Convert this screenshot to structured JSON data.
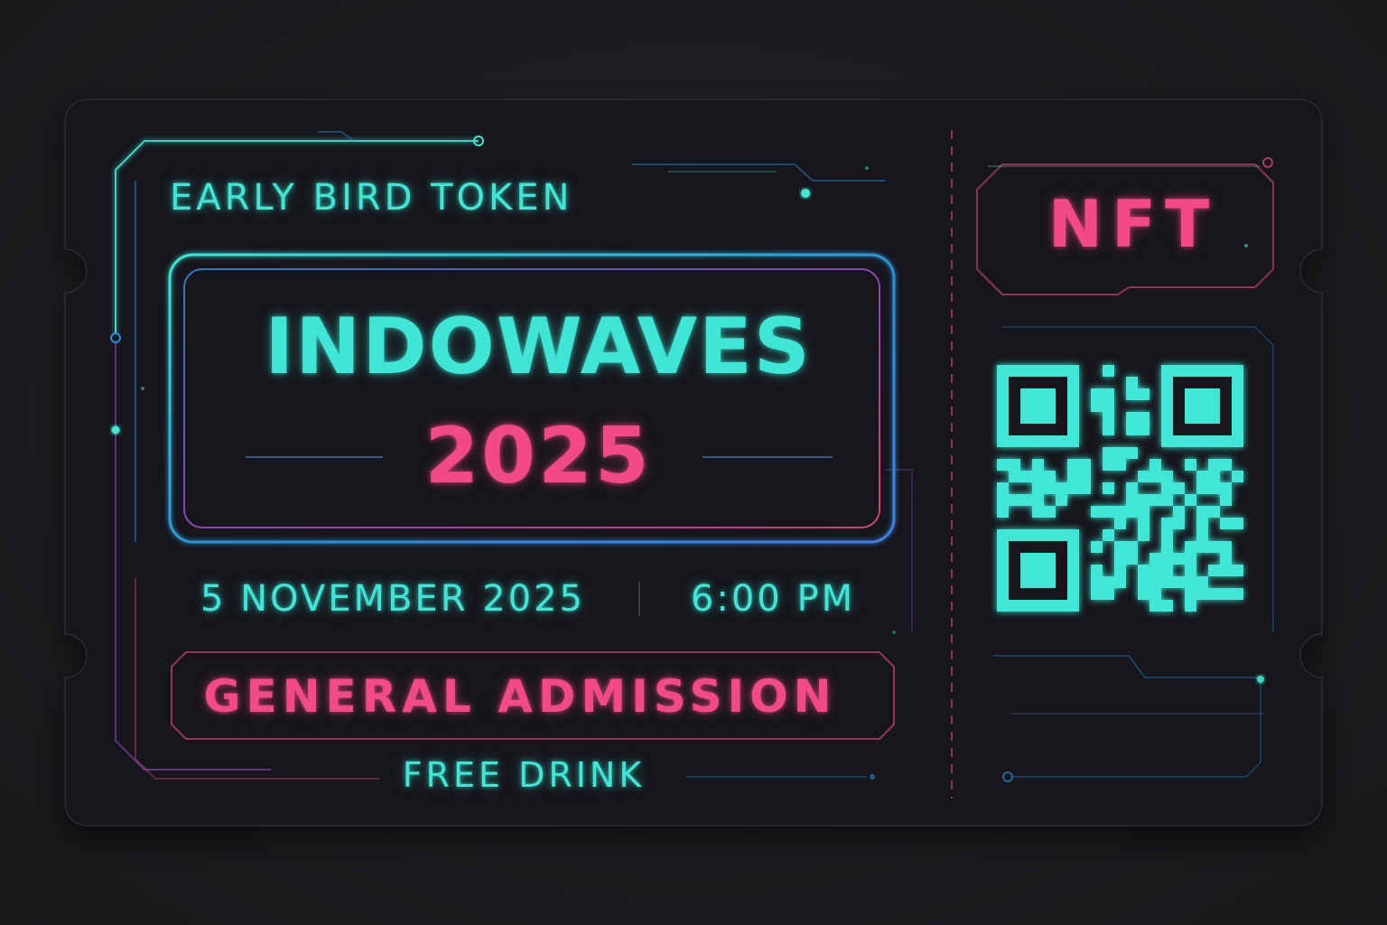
{
  "ticket": {
    "tier_label": "EARLY BIRD TOKEN",
    "event_name": "INDOWAVES",
    "event_year": "2025",
    "date": "5 NOVEMBER 2025",
    "time": "6:00 PM",
    "admission_type": "GENERAL ADMISSION",
    "perk": "FREE DRINK",
    "badge": "NFT"
  },
  "qr": {
    "icon": "qr-code-icon"
  },
  "colors": {
    "background": "#1b1c1f",
    "ticket_body": "#16171a",
    "accent_cyan": "#3fe6d6",
    "accent_pink": "#f24a86",
    "accent_blue": "#2a8fd6"
  }
}
